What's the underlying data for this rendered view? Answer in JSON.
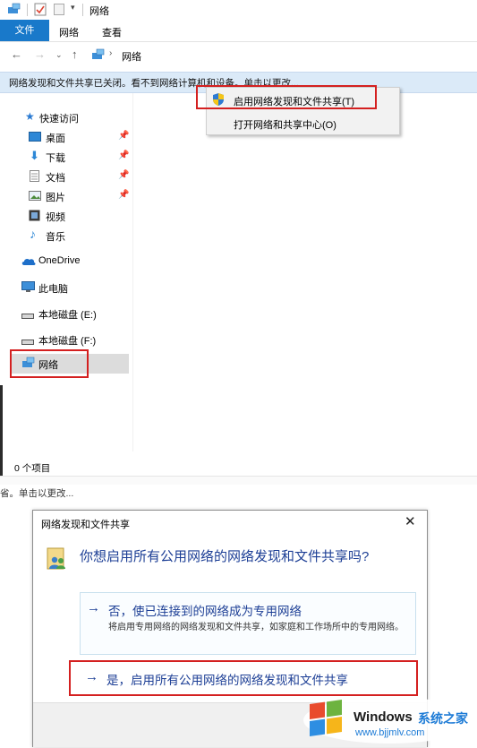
{
  "explorer": {
    "title": "网络",
    "ribbon_tabs": [
      "文件",
      "网络",
      "查看"
    ],
    "breadcrumb": "网络",
    "infobar_text": "网络发现和文件共享已关闭。看不到网络计算机和设备。单击以更改...",
    "context_menu": [
      "启用网络发现和文件共享(T)",
      "打开网络和共享中心(O)"
    ],
    "nav": {
      "quick_access": "快速访问",
      "desktop": "桌面",
      "downloads": "下载",
      "documents": "文档",
      "pictures": "图片",
      "videos": "视频",
      "music": "音乐",
      "onedrive": "OneDrive",
      "this_pc": "此电脑",
      "drive_e": "本地磁盘 (E:)",
      "drive_f": "本地磁盘 (F:)",
      "network": "网络"
    },
    "status": "0 个项目",
    "cut_text": "省。单击以更改..."
  },
  "dialog": {
    "title": "网络发现和文件共享",
    "question": "你想启用所有公用网络的网络发现和文件共享吗?",
    "option1_title": "否，使已连接到的网络成为专用网络",
    "option1_desc": "将启用专用网络的网络发现和文件共享，如家庭和工作场所中的专用网络。",
    "option2_title": "是，启用所有公用网络的网络发现和文件共享"
  },
  "watermark": {
    "brand": "Windows",
    "site_name": "系统之家",
    "url": "www.bjjmlv.com"
  },
  "colors": {
    "accent": "#1979ca",
    "highlight_box": "#d42020",
    "link_blue": "#1c3e95",
    "infobar": "#dbeaf8"
  }
}
